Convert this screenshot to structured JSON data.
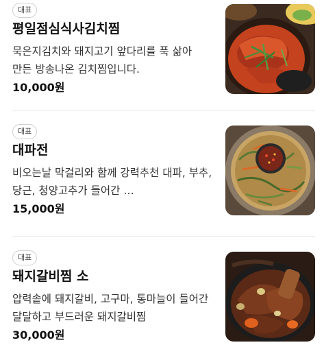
{
  "menu": {
    "items": [
      {
        "badge": "대표",
        "name": "평일점심식사김치찜",
        "description": "묵은지김치와 돼지고기 앞다리를 푹 삶아 만든 방송나온 김치찜입니다.",
        "price": "10,000원",
        "image": "kimchi-jjim-photo"
      },
      {
        "badge": "대표",
        "name": "대파전",
        "description": "비오는날 막걸리와 함께 강력추천 대파, 부추, 당근, 청양고추가 들어간 …",
        "price": "15,000원",
        "image": "green-onion-pancake-photo"
      },
      {
        "badge": "대표",
        "name": "돼지갈비찜 소",
        "description": "압력솥에 돼지갈비, 고구마, 통마늘이 들어간 달달하고 부드러운 돼지갈비찜",
        "price": "30,000원",
        "image": "braised-pork-ribs-photo"
      }
    ]
  }
}
